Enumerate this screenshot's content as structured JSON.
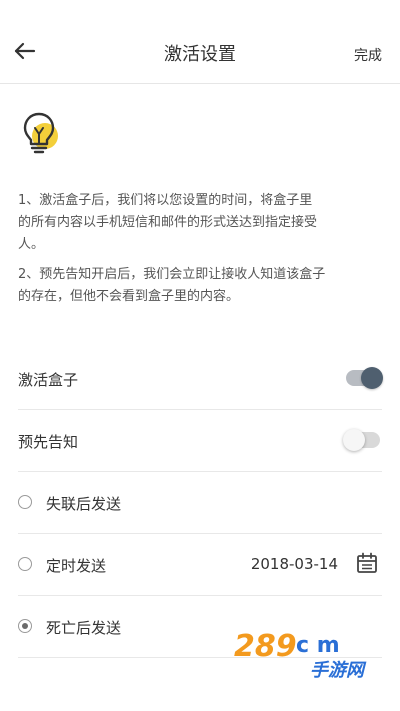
{
  "header": {
    "title": "激活设置",
    "done_label": "完成",
    "back_icon": "arrow-left-icon"
  },
  "info": {
    "icon": "lightbulb-icon",
    "paragraph_1_lines": [
      "1、激活盒子后，我们将以您设置的时间，将盒子里",
      "的所有内容以手机短信和邮件的形式送达到指定接受",
      "人。"
    ],
    "paragraph_2_lines": [
      "2、预先告知开启后，我们会立即让接收人知道该盒子",
      "的存在，但他不会看到盒子里的内容。"
    ]
  },
  "settings": {
    "activate_box": {
      "label": "激活盒子",
      "enabled": true
    },
    "advance_notice": {
      "label": "预先告知",
      "enabled": false
    }
  },
  "send_options": [
    {
      "label": "失联后发送",
      "selected": false
    },
    {
      "label": "定时发送",
      "selected": false,
      "date": "2018-03-14",
      "icon": "calendar-icon"
    },
    {
      "label": "死亡后发送",
      "selected": true
    }
  ],
  "watermark": {
    "brand": "289",
    "suffix": "c m",
    "tagline": "手游网"
  },
  "colors": {
    "toggle_on_knob": "#4f5f6f",
    "toggle_on_track": "#b8bcc2",
    "toggle_off_track": "#d9d9d9",
    "bulb_yellow": "#f3cf3a",
    "watermark_orange": "#f39a1e",
    "watermark_blue": "#2a6fd6"
  }
}
